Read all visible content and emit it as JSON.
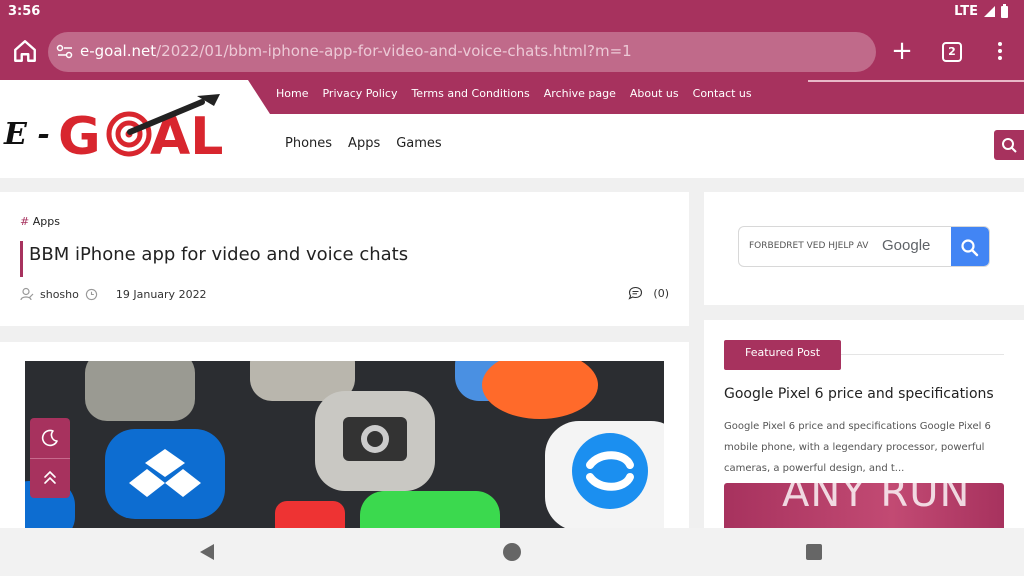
{
  "status_bar": {
    "time": "3:56",
    "network": "LTE"
  },
  "browser": {
    "url_host": "e-goal.net",
    "url_path": "/2022/01/bbm-iphone-app-for-video-and-voice-chats.html?m=1",
    "tab_count": "2",
    "new_tab_label": "+"
  },
  "site": {
    "logo_text": "E - GOAL",
    "top_nav": [
      "Home",
      "Privacy Policy",
      "Terms and Conditions",
      "Archive page",
      "About us",
      "Contact us"
    ],
    "main_nav": [
      "Phones",
      "Apps",
      "Games"
    ]
  },
  "article": {
    "category_hash": "#",
    "category": "Apps",
    "title": "BBM iPhone app for video and voice chats",
    "author": "shosho",
    "date": "19 January 2022",
    "comments": "(0)"
  },
  "sidebar": {
    "search_label": "FORBEDRET VED HJELP AV",
    "search_brand": "Google",
    "featured_badge": "Featured Post",
    "featured_title": "Google Pixel 6 price and specifications",
    "featured_excerpt": "Google Pixel 6 price and specifications Google Pixel 6 mobile phone, with a legendary processor, powerful cameras, a powerful design, and t..."
  },
  "watermark": "ANY RUN",
  "colors": {
    "brand": "#a7325e",
    "google_blue": "#4285f4"
  }
}
